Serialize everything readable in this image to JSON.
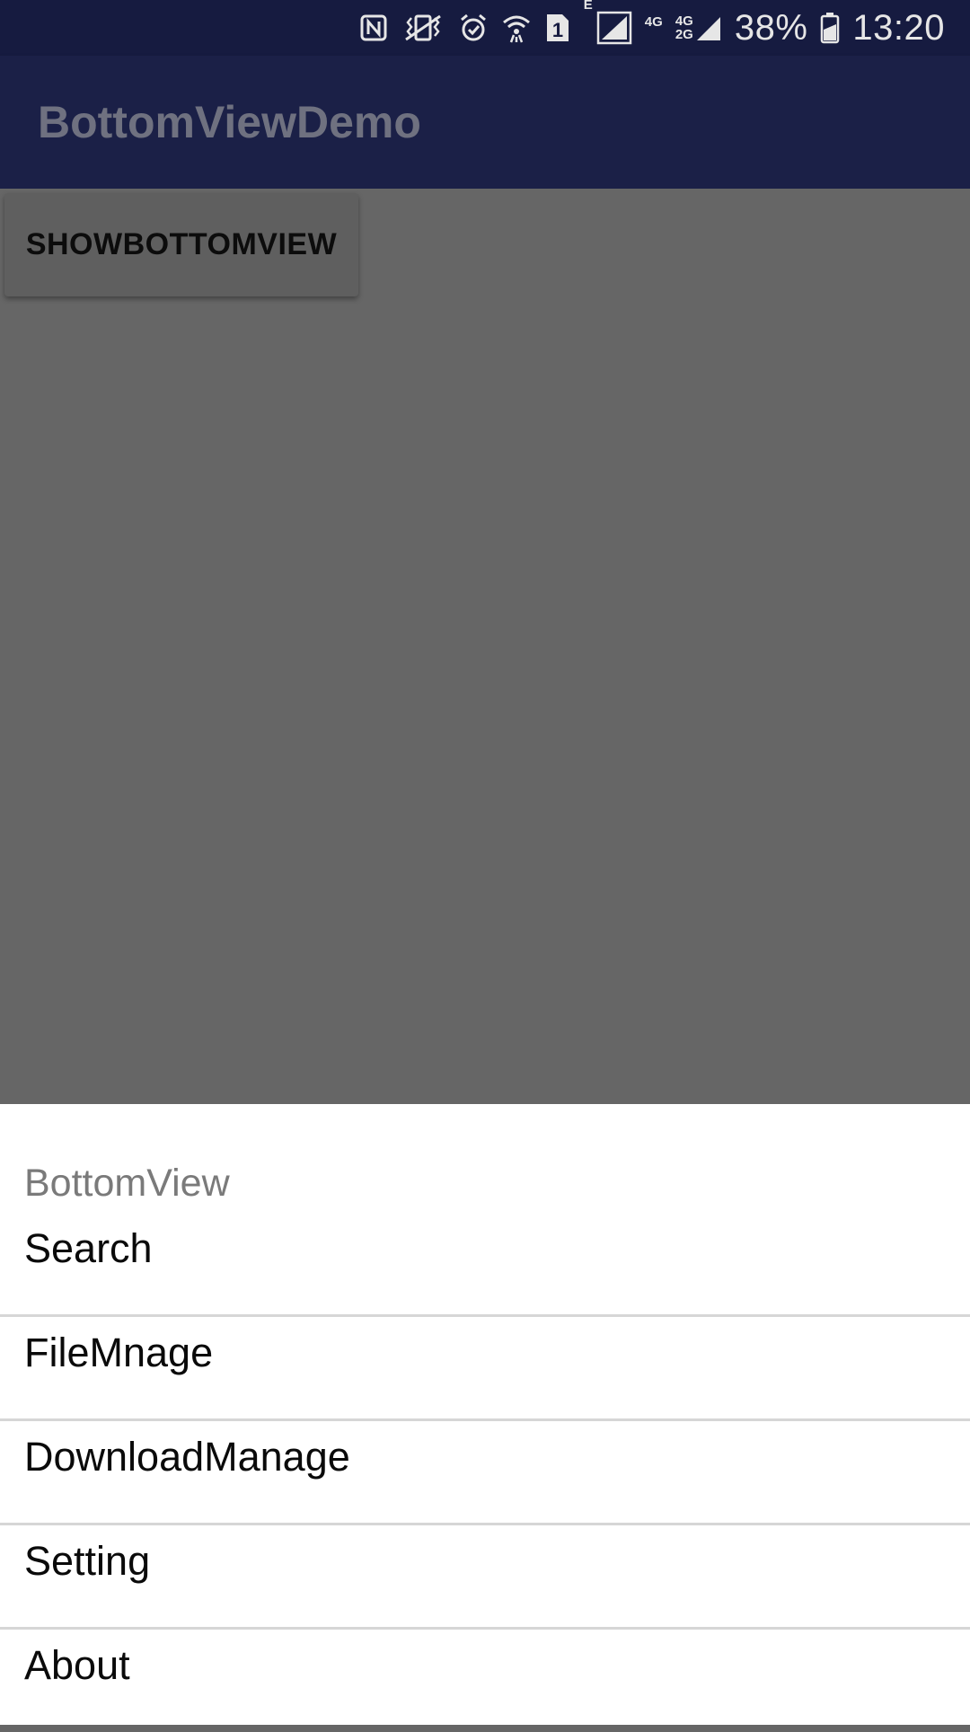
{
  "status_bar": {
    "battery_percent": "38%",
    "time": "13:20",
    "net_e": "E",
    "net_4g": "4G",
    "net_4g2": "4G",
    "net_2g": "2G",
    "sim_slot": "1",
    "icons": [
      "nfc-icon",
      "vibrate-icon",
      "alarm-icon",
      "wifi-icon",
      "sim-1-icon",
      "signal-icon",
      "signal-icon-2",
      "battery-icon"
    ]
  },
  "app_bar": {
    "title": "BottomViewDemo"
  },
  "main": {
    "show_button_label": "SHOWBOTTOMVIEW"
  },
  "bottom_sheet": {
    "title": "BottomView",
    "items": [
      {
        "label": "Search"
      },
      {
        "label": "FileMnage"
      },
      {
        "label": "DownloadManage"
      },
      {
        "label": "Setting"
      },
      {
        "label": "About"
      }
    ]
  },
  "colors": {
    "status_bar": "#161b40",
    "app_bar": "#1b2047",
    "scrim": "#666666",
    "sheet": "#ffffff",
    "divider": "#d6d6d6"
  }
}
